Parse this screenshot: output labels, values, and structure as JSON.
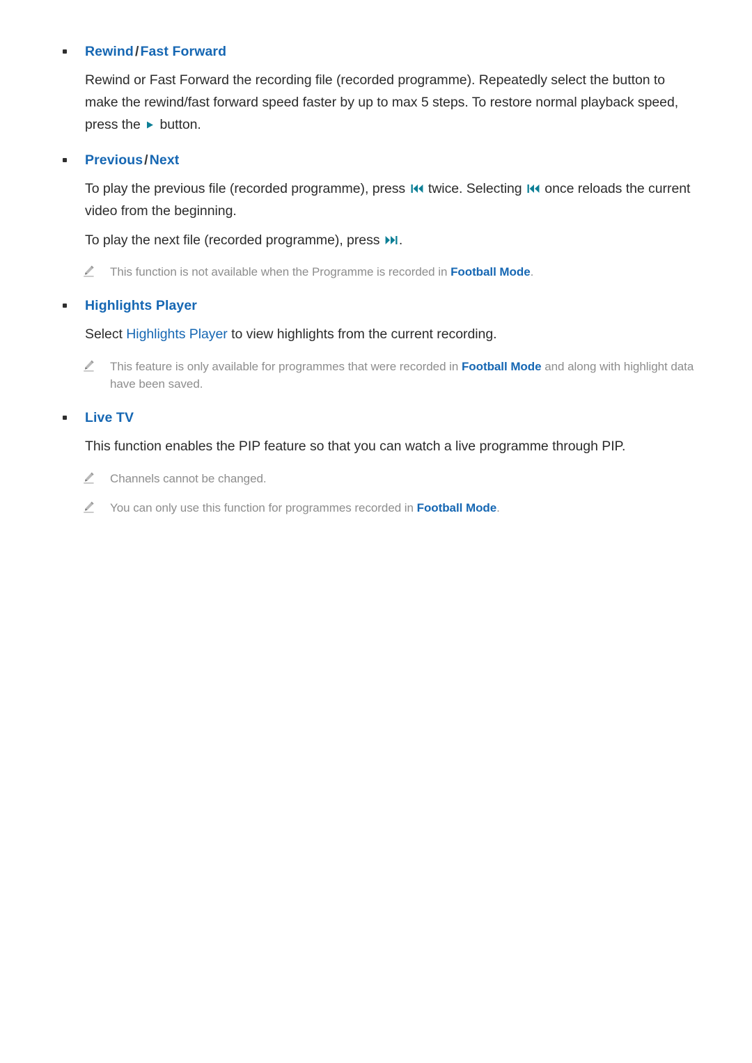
{
  "page": {
    "background": "#ffffff",
    "heading_color": "#1667b3",
    "body_color": "#2b2b2b",
    "note_color": "#8d8d8d",
    "glyph_color": "#0d7f96"
  },
  "sections": [
    {
      "id": "rewind-fast-forward",
      "heading": {
        "primary": "Rewind",
        "separator": "/",
        "secondary": "Fast Forward"
      },
      "body": [
        {
          "id": "rewind-body",
          "parts": [
            {
              "type": "text",
              "value": "Rewind or Fast Forward the recording file (recorded programme). Repeatedly select the button to make the rewind/fast forward speed faster by up to max 5 steps. To restore normal playback speed, press the "
            },
            {
              "type": "glyph",
              "icon": "play-icon"
            },
            {
              "type": "text",
              "value": " button."
            }
          ]
        }
      ],
      "notes": []
    },
    {
      "id": "previous-next",
      "heading": {
        "primary": "Previous",
        "separator": "/",
        "secondary": "Next"
      },
      "body": [
        {
          "id": "previous-body",
          "parts": [
            {
              "type": "text",
              "value": "To play the previous file (recorded programme), press "
            },
            {
              "type": "glyph",
              "icon": "skip-back-icon"
            },
            {
              "type": "text",
              "value": " twice. Selecting "
            },
            {
              "type": "glyph",
              "icon": "skip-back-icon"
            },
            {
              "type": "text",
              "value": " once reloads the current video from the beginning."
            }
          ]
        },
        {
          "id": "next-body",
          "parts": [
            {
              "type": "text",
              "value": "To play the next file (recorded programme), press "
            },
            {
              "type": "glyph",
              "icon": "skip-forward-icon"
            },
            {
              "type": "text",
              "value": "."
            }
          ]
        }
      ],
      "notes": [
        {
          "id": "note-football-mode-unavailable",
          "icon": "pencil-note-icon",
          "parts": [
            {
              "type": "text",
              "value": "This function is not available when the Programme is recorded in "
            },
            {
              "type": "term",
              "value": "Football Mode"
            },
            {
              "type": "text",
              "value": "."
            }
          ]
        }
      ]
    },
    {
      "id": "highlights-player",
      "heading": {
        "primary": "Highlights Player",
        "separator": "",
        "secondary": ""
      },
      "body": [
        {
          "id": "highlights-body",
          "parts": [
            {
              "type": "text",
              "value": "Select "
            },
            {
              "type": "accent",
              "value": "Highlights Player"
            },
            {
              "type": "text",
              "value": " to view highlights from the current recording."
            }
          ]
        }
      ],
      "notes": [
        {
          "id": "note-highlights-football-mode",
          "icon": "pencil-note-icon",
          "parts": [
            {
              "type": "text",
              "value": "This feature is only available for programmes that were recorded in "
            },
            {
              "type": "term",
              "value": "Football Mode"
            },
            {
              "type": "text",
              "value": " and along with highlight data have been saved."
            }
          ]
        }
      ]
    },
    {
      "id": "live-tv",
      "heading": {
        "primary": "Live TV",
        "separator": "",
        "secondary": ""
      },
      "body": [
        {
          "id": "live-tv-body",
          "parts": [
            {
              "type": "text",
              "value": "This function enables the PIP feature so that you can watch a live programme through PIP."
            }
          ]
        }
      ],
      "notes": [
        {
          "id": "note-channels-cannot-change",
          "icon": "pencil-note-icon",
          "parts": [
            {
              "type": "text",
              "value": "Channels cannot be changed."
            }
          ]
        },
        {
          "id": "note-live-tv-football-mode",
          "icon": "pencil-note-icon",
          "parts": [
            {
              "type": "text",
              "value": "You can only use this function for programmes recorded in "
            },
            {
              "type": "term",
              "value": "Football Mode"
            },
            {
              "type": "text",
              "value": "."
            }
          ]
        }
      ]
    }
  ]
}
